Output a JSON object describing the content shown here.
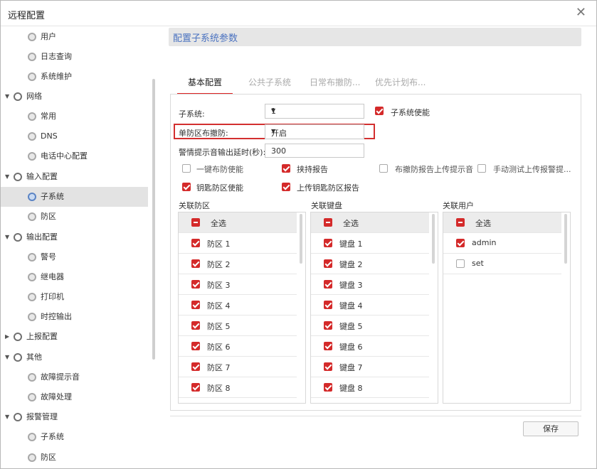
{
  "window": {
    "title": "远程配置"
  },
  "tree": [
    {
      "label": "用户",
      "level": 2,
      "icon": "gear-gray"
    },
    {
      "label": "日志查询",
      "level": 2,
      "icon": "gear-gray"
    },
    {
      "label": "系统维护",
      "level": 2,
      "icon": "gear-gray"
    },
    {
      "label": "网络",
      "level": 1,
      "icon": "gear-parent",
      "expanded": true
    },
    {
      "label": "常用",
      "level": 2,
      "icon": "gear-gray"
    },
    {
      "label": "DNS",
      "level": 2,
      "icon": "gear-gray"
    },
    {
      "label": "电话中心配置",
      "level": 2,
      "icon": "gear-gray"
    },
    {
      "label": "输入配置",
      "level": 1,
      "icon": "gear-parent",
      "expanded": true
    },
    {
      "label": "子系统",
      "level": 2,
      "icon": "gear-blue",
      "selected": true
    },
    {
      "label": "防区",
      "level": 2,
      "icon": "gear-gray"
    },
    {
      "label": "输出配置",
      "level": 1,
      "icon": "gear-parent",
      "expanded": true
    },
    {
      "label": "警号",
      "level": 2,
      "icon": "gear-gray"
    },
    {
      "label": "继电器",
      "level": 2,
      "icon": "gear-gray"
    },
    {
      "label": "打印机",
      "level": 2,
      "icon": "gear-gray"
    },
    {
      "label": "时控输出",
      "level": 2,
      "icon": "gear-gray"
    },
    {
      "label": "上报配置",
      "level": 1,
      "icon": "gear-parent",
      "expanded": false
    },
    {
      "label": "其他",
      "level": 1,
      "icon": "gear-parent",
      "expanded": true
    },
    {
      "label": "故障提示音",
      "level": 2,
      "icon": "gear-gray"
    },
    {
      "label": "故障处理",
      "level": 2,
      "icon": "gear-gray"
    },
    {
      "label": "报警管理",
      "level": 1,
      "icon": "gear-parent",
      "expanded": true
    },
    {
      "label": "子系统",
      "level": 2,
      "icon": "gear-gray"
    },
    {
      "label": "防区",
      "level": 2,
      "icon": "gear-gray"
    }
  ],
  "panel": {
    "title": "配置子系统参数"
  },
  "tabs": [
    "基本配置",
    "公共子系统",
    "日常布撤防...",
    "优先计划布..."
  ],
  "form": {
    "subsystem_label": "子系统:",
    "subsystem_value": "1",
    "subsystem_enable_label": "子系统使能",
    "subsystem_enable_checked": true,
    "single_zone_label": "单防区布撤防:",
    "single_zone_value": "开启",
    "alarm_delay_label": "警情提示音输出延时(秒):",
    "alarm_delay_value": "300"
  },
  "options": [
    {
      "label": "一键布防使能",
      "checked": false
    },
    {
      "label": "挟持报告",
      "checked": true
    },
    {
      "label": "布撤防报告上传提示音",
      "checked": false
    },
    {
      "label": "手动测试上传报警提...",
      "checked": false
    },
    {
      "label": "钥匙防区使能",
      "checked": true
    },
    {
      "label": "上传钥匙防区报告",
      "checked": true
    }
  ],
  "lists": {
    "zones": {
      "title": "关联防区",
      "select_all": "全选",
      "items": [
        "防区 1",
        "防区 2",
        "防区 3",
        "防区 4",
        "防区 5",
        "防区 6",
        "防区 7",
        "防区 8"
      ]
    },
    "keyboards": {
      "title": "关联键盘",
      "select_all": "全选",
      "items": [
        "键盘 1",
        "键盘 2",
        "键盘 3",
        "键盘 4",
        "键盘 5",
        "键盘 6",
        "键盘 7",
        "键盘 8"
      ]
    },
    "users": {
      "title": "关联用户",
      "select_all": "全选",
      "items": [
        {
          "name": "admin",
          "checked": true
        },
        {
          "name": "set",
          "checked": false
        }
      ]
    }
  },
  "buttons": {
    "save": "保存"
  },
  "colors": {
    "accent": "#d42a2a",
    "panel_title": "#4a72c0",
    "selected_row": "#e3e3e3"
  }
}
